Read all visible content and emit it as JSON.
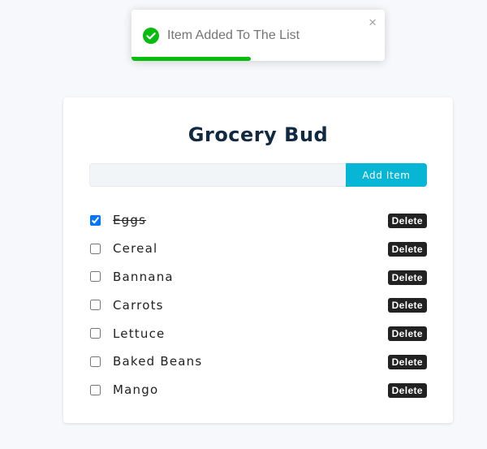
{
  "toast": {
    "message": "Item Added To The List",
    "close_glyph": "×",
    "icon": "check-circle-icon",
    "color": "#07bc0c",
    "progress": 0.47
  },
  "app": {
    "title": "Grocery Bud",
    "input_value": "",
    "add_label": "Add Item",
    "delete_label": "Delete",
    "accent": "#06b6d4"
  },
  "items": [
    {
      "name": "Eggs",
      "checked": true
    },
    {
      "name": "Cereal",
      "checked": false
    },
    {
      "name": "Bannana",
      "checked": false
    },
    {
      "name": "Carrots",
      "checked": false
    },
    {
      "name": "Lettuce",
      "checked": false
    },
    {
      "name": "Baked Beans",
      "checked": false
    },
    {
      "name": "Mango",
      "checked": false
    }
  ]
}
